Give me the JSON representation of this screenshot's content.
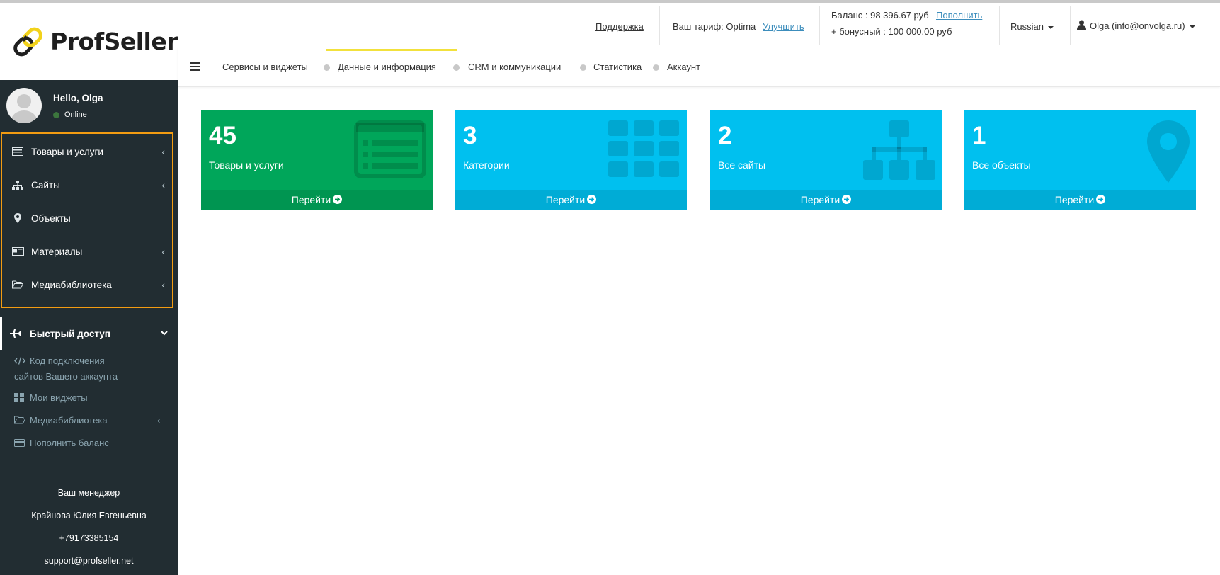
{
  "app": {
    "logo_text": "ProfSeller"
  },
  "header": {
    "support": "Поддержка",
    "tariff_label": "Ваш тариф: Optima",
    "tariff_upgrade": "Улучшить",
    "balance_label": "Баланс : 98 396.67 руб",
    "balance_topup": "Пополнить",
    "bonus_label": "+ бонусный : 100 000.00 руб",
    "language": "Russian",
    "user_account": "Olga (info@onvolga.ru)"
  },
  "nav": {
    "tabs": [
      {
        "label": "Сервисы и виджеты"
      },
      {
        "label": "Данные и информация"
      },
      {
        "label": "CRM и коммуникации"
      },
      {
        "label": "Статистика"
      },
      {
        "label": "Аккаунт"
      }
    ],
    "active_index": 1
  },
  "sidebar": {
    "greeting": "Hello, Olga",
    "status": "Online",
    "items": [
      {
        "label": "Товары и услуги",
        "icon": "list-icon"
      },
      {
        "label": "Сайты",
        "icon": "sitemap-icon"
      },
      {
        "label": "Объекты",
        "icon": "map-pin-icon"
      },
      {
        "label": "Материалы",
        "icon": "newspaper-icon"
      },
      {
        "label": "Медиабиблиотека",
        "icon": "folder-open-icon"
      }
    ],
    "quick_access": {
      "label": "Быстрый доступ",
      "icon": "plane-icon"
    },
    "quick_items": [
      {
        "label_line1": "Код подключения",
        "label_line2": "сайтов Вашего аккаунта",
        "icon": "code-icon"
      },
      {
        "label": "Мои виджеты",
        "icon": "grid-icon"
      },
      {
        "label": "Медиабиблиотека",
        "icon": "folder-open-icon"
      },
      {
        "label": "Пополнить баланс",
        "icon": "credit-card-icon"
      }
    ],
    "manager": {
      "title": "Ваш менеджер",
      "name": "Крайнова Юлия Евгеньевна",
      "phone": "+79173385154",
      "email": "support@profseller.net"
    }
  },
  "cards": [
    {
      "count": "45",
      "label": "Товары и услуги",
      "action": "Перейти",
      "color": "#00a65a",
      "foot_color": "#009551",
      "icon": "list-alt-icon"
    },
    {
      "count": "3",
      "label": "Категории",
      "action": "Перейти",
      "color": "#00c0ef",
      "foot_color": "#00acd6",
      "icon": "grid-icon"
    },
    {
      "count": "2",
      "label": "Все сайты",
      "action": "Перейти",
      "color": "#00c0ef",
      "foot_color": "#00acd6",
      "icon": "sitemap-icon"
    },
    {
      "count": "1",
      "label": "Все объекты",
      "action": "Перейти",
      "color": "#00c0ef",
      "foot_color": "#00acd6",
      "icon": "map-marker-icon"
    }
  ],
  "colors": {
    "sidebar_bg": "#222d32",
    "highlight_border": "#f39c12",
    "active_tab_bar": "#f2e13c",
    "link": "#3c8dbc"
  }
}
